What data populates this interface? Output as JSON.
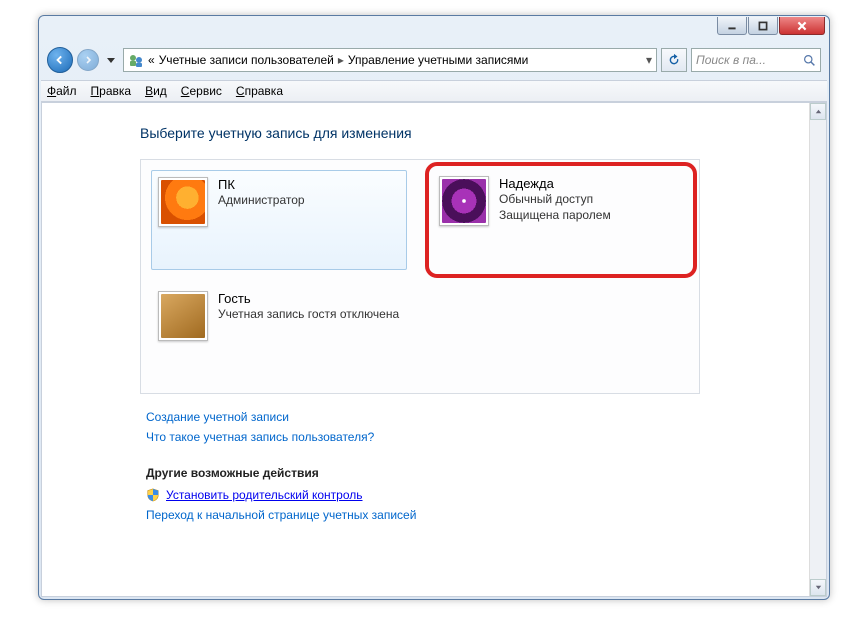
{
  "breadcrumb": {
    "prefix": "«",
    "seg1": "Учетные записи пользователей",
    "seg2": "Управление учетными записями"
  },
  "search": {
    "placeholder": "Поиск в па..."
  },
  "menu": {
    "file": "Файл",
    "edit": "Правка",
    "view": "Вид",
    "tools": "Сервис",
    "help": "Справка"
  },
  "page": {
    "title": "Выберите учетную запись для изменения"
  },
  "accounts": [
    {
      "name": "ПК",
      "line1": "Администратор",
      "line2": ""
    },
    {
      "name": "Надежда",
      "line1": "Обычный доступ",
      "line2": "Защищена паролем"
    },
    {
      "name": "Гость",
      "line1": "Учетная запись гостя отключена",
      "line2": ""
    }
  ],
  "links": {
    "create": "Создание учетной записи",
    "what": "Что такое учетная запись пользователя?",
    "other_header": "Другие возможные действия",
    "parental": "Установить родительский контроль",
    "home": "Переход к начальной странице учетных записей"
  }
}
